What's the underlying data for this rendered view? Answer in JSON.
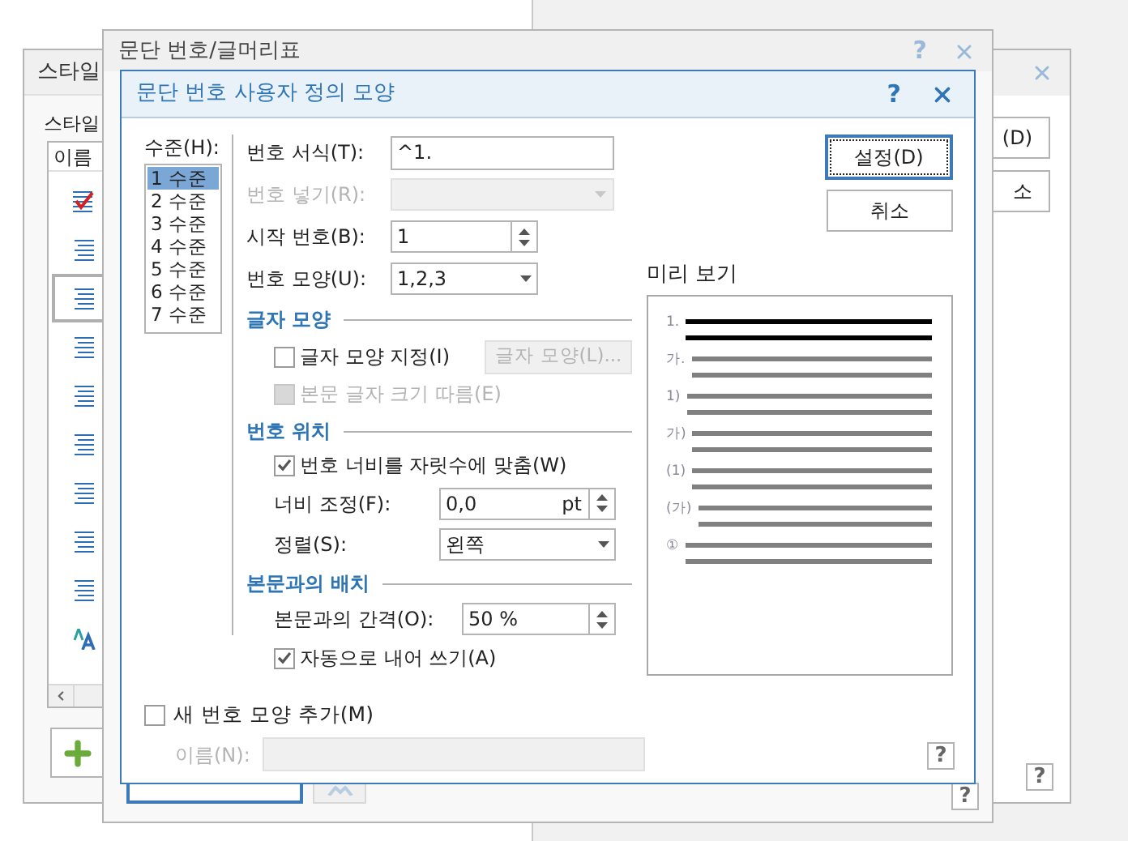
{
  "style_window": {
    "title": "스타일",
    "label": "스타일",
    "column": "이름",
    "items": [
      {
        "kind": "check",
        "selected": false
      },
      {
        "kind": "paragraph",
        "selected": false
      },
      {
        "kind": "paragraph",
        "selected": true
      },
      {
        "kind": "paragraph",
        "selected": false
      },
      {
        "kind": "paragraph",
        "selected": false
      },
      {
        "kind": "paragraph",
        "selected": false
      },
      {
        "kind": "paragraph",
        "selected": false
      },
      {
        "kind": "paragraph",
        "selected": false
      },
      {
        "kind": "paragraph",
        "selected": false
      },
      {
        "kind": "character",
        "selected": false
      }
    ]
  },
  "back_window": {
    "buttons": [
      "(D)",
      "소"
    ],
    "help_button": "?"
  },
  "numbering_dialog": {
    "title": "문단 번호/글머리표",
    "help": "?",
    "help_button": "?"
  },
  "custom_dialog": {
    "title": "문단 번호 사용자 정의 모양",
    "help": "?",
    "levels_label": "수준(H):",
    "levels": [
      {
        "label": "1 수준",
        "selected": true
      },
      {
        "label": "2 수준",
        "selected": false
      },
      {
        "label": "3 수준",
        "selected": false
      },
      {
        "label": "4 수준",
        "selected": false
      },
      {
        "label": "5 수준",
        "selected": false
      },
      {
        "label": "6 수준",
        "selected": false
      },
      {
        "label": "7 수준",
        "selected": false
      }
    ],
    "format": {
      "label": "번호 서식(T):",
      "value": "^1."
    },
    "insert": {
      "label": "번호 넣기(R):",
      "disabled": true
    },
    "start": {
      "label": "시작 번호(B):",
      "value": "1"
    },
    "shape": {
      "label": "번호 모양(U):",
      "value": "1,2,3"
    },
    "char_section": "글자 모양",
    "char_shape": {
      "label": "글자 모양 지정(I)",
      "checked": false,
      "button": "글자 모양(L)..."
    },
    "follow_size": {
      "label": "본문 글자 크기 따름(E)",
      "disabled": true
    },
    "pos_section": "번호 위치",
    "fit_width": {
      "label": "번호 너비를 자릿수에 맞춤(W)",
      "checked": true
    },
    "width_adjust": {
      "label": "너비 조정(F):",
      "value": "0,0",
      "unit": "pt"
    },
    "align": {
      "label": "정렬(S):",
      "value": "왼쪽"
    },
    "layout_section": "본문과의 배치",
    "spacing": {
      "label": "본문과의 간격(O):",
      "value": "50 %"
    },
    "auto_indent": {
      "label": "자동으로 내어 쓰기(A)",
      "checked": true
    },
    "add_new": {
      "label": "새 번호 모양 추가(M)",
      "checked": false
    },
    "name": {
      "label": "이름(N):",
      "disabled": true
    },
    "ok": "설정(D)",
    "cancel": "취소",
    "preview_label": "미리 보기",
    "preview": [
      {
        "label": "1.",
        "current": true
      },
      {
        "label": "가.",
        "current": false
      },
      {
        "label": "1)",
        "current": false
      },
      {
        "label": "가)",
        "current": false
      },
      {
        "label": "(1)",
        "current": false
      },
      {
        "label": "(가)",
        "current": false
      },
      {
        "label": "①",
        "current": false
      }
    ],
    "help_button": "?"
  }
}
